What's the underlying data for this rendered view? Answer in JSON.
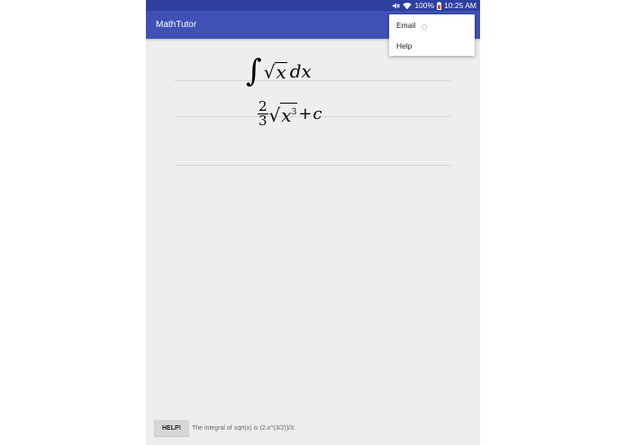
{
  "status_bar": {
    "battery": "100%",
    "time": "10:25 AM",
    "icons": [
      "mute-icon",
      "wifi-icon",
      "battery-icon"
    ]
  },
  "app_bar": {
    "title": "MathTutor"
  },
  "overflow_menu": {
    "items": [
      {
        "label": "Email"
      },
      {
        "label": "Help"
      }
    ]
  },
  "problem": {
    "integral_symbol": "∫",
    "sqrt_symbol": "√",
    "radicand": "x",
    "differential": "dx"
  },
  "answer": {
    "numerator": "2",
    "denominator": "3",
    "sqrt_symbol": "√",
    "radicand_base": "x",
    "exponent": "3",
    "plus": "+",
    "constant": "c"
  },
  "help_bar": {
    "button_label": "HELP!",
    "hint": "The integral of sqrt(x) is (2.x^(3/2))/3:"
  },
  "colors": {
    "status_bar": "#2f3f9e",
    "app_bar": "#3f51b5",
    "background": "#eeeeee"
  }
}
